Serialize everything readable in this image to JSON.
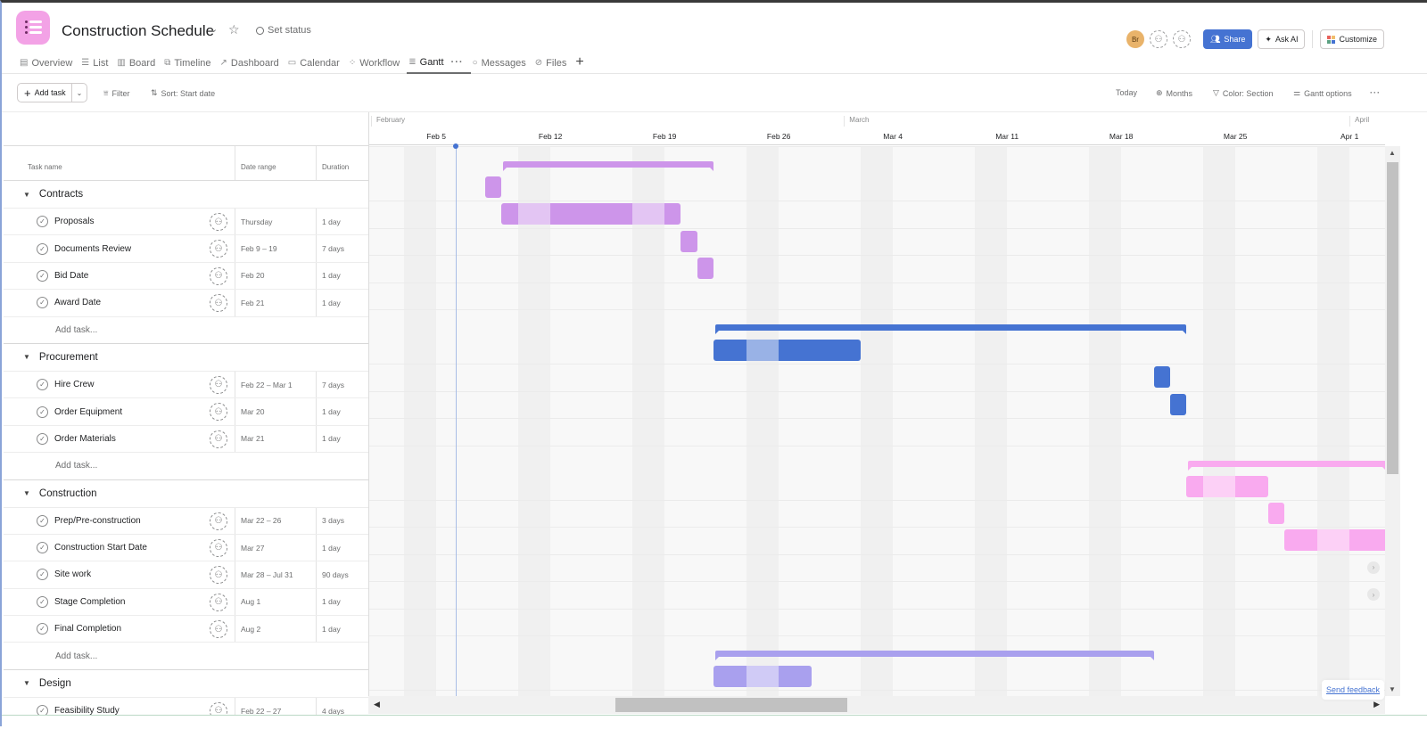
{
  "project": {
    "title": "Construction Schedule",
    "set_status": "Set status",
    "icon_color": "#f3a2e6"
  },
  "tabs": [
    {
      "label": "Overview",
      "icon": "overview-icon",
      "glyph": "▤"
    },
    {
      "label": "List",
      "icon": "list-icon",
      "glyph": "☰"
    },
    {
      "label": "Board",
      "icon": "board-icon",
      "glyph": "▥"
    },
    {
      "label": "Timeline",
      "icon": "timeline-icon",
      "glyph": "⧉"
    },
    {
      "label": "Dashboard",
      "icon": "dashboard-icon",
      "glyph": "↗"
    },
    {
      "label": "Calendar",
      "icon": "calendar-icon",
      "glyph": "▭"
    },
    {
      "label": "Workflow",
      "icon": "workflow-icon",
      "glyph": "⁘"
    },
    {
      "label": "Gantt",
      "icon": "gantt-icon",
      "glyph": "≣",
      "active": true
    },
    {
      "label": "Messages",
      "icon": "messages-icon",
      "glyph": "○"
    },
    {
      "label": "Files",
      "icon": "files-icon",
      "glyph": "⊘"
    }
  ],
  "header_right": {
    "avatar_initials": "Br",
    "share_label": "Share",
    "ask_ai_label": "Ask AI",
    "customize_label": "Customize",
    "share_color": "#4573d2"
  },
  "toolbar": {
    "add_task_label": "Add task",
    "filter_label": "Filter",
    "sort_label": "Sort: Start date",
    "today_label": "Today",
    "zoom_label": "Months",
    "color_label": "Color: Section",
    "options_label": "Gantt options"
  },
  "list_header": {
    "name": "Task name",
    "date": "Date range",
    "duration": "Duration"
  },
  "add_task_row_label": "Add task...",
  "sections": [
    {
      "name": "Contracts",
      "color": "#cd95ea",
      "bracket": {
        "start": "2024-02-09",
        "end": "2024-02-21"
      },
      "tasks": [
        {
          "name": "Proposals",
          "date_range": "Thursday",
          "duration": "1 day",
          "start": "2024-02-08",
          "end": "2024-02-08"
        },
        {
          "name": "Documents Review",
          "date_range": "Feb 9 – 19",
          "duration": "7 days",
          "start": "2024-02-09",
          "end": "2024-02-19"
        },
        {
          "name": "Bid Date",
          "date_range": "Feb 20",
          "duration": "1 day",
          "start": "2024-02-20",
          "end": "2024-02-20"
        },
        {
          "name": "Award Date",
          "date_range": "Feb 21",
          "duration": "1 day",
          "start": "2024-02-21",
          "end": "2024-02-21"
        }
      ],
      "has_add_row": true
    },
    {
      "name": "Procurement",
      "color": "#4573d2",
      "bracket": {
        "start": "2024-02-22",
        "end": "2024-03-21"
      },
      "tasks": [
        {
          "name": "Hire Crew",
          "date_range": "Feb 22 – Mar 1",
          "duration": "7 days",
          "start": "2024-02-22",
          "end": "2024-03-01"
        },
        {
          "name": "Order Equipment",
          "date_range": "Mar 20",
          "duration": "1 day",
          "start": "2024-03-20",
          "end": "2024-03-20"
        },
        {
          "name": "Order Materials",
          "date_range": "Mar 21",
          "duration": "1 day",
          "start": "2024-03-21",
          "end": "2024-03-21"
        }
      ],
      "has_add_row": true
    },
    {
      "name": "Construction",
      "color": "#f9aaef",
      "bracket": {
        "start": "2024-03-22",
        "end": "2024-08-02"
      },
      "tasks": [
        {
          "name": "Prep/Pre-construction",
          "date_range": "Mar 22 – 26",
          "duration": "3 days",
          "start": "2024-03-22",
          "end": "2024-03-26"
        },
        {
          "name": "Construction Start Date",
          "date_range": "Mar 27",
          "duration": "1 day",
          "start": "2024-03-27",
          "end": "2024-03-27"
        },
        {
          "name": "Site work",
          "date_range": "Mar 28 – Jul 31",
          "duration": "90 days",
          "start": "2024-03-28",
          "end": "2024-07-31"
        },
        {
          "name": "Stage Completion",
          "date_range": "Aug 1",
          "duration": "1 day",
          "start": "2024-08-01",
          "end": "2024-08-01",
          "offscreen": true
        },
        {
          "name": "Final Completion",
          "date_range": "Aug 2",
          "duration": "1 day",
          "start": "2024-08-02",
          "end": "2024-08-02",
          "offscreen": true
        }
      ],
      "has_add_row": true
    },
    {
      "name": "Design",
      "color": "#a9a0ee",
      "bracket": {
        "start": "2024-02-22",
        "end": "2024-03-19"
      },
      "tasks": [
        {
          "name": "Feasibility Study",
          "date_range": "Feb 22 – 27",
          "duration": "4 days",
          "start": "2024-02-22",
          "end": "2024-02-27"
        }
      ],
      "has_add_row": false
    }
  ],
  "timeline": {
    "months": [
      {
        "label": "February",
        "date": "2024-02-01"
      },
      {
        "label": "March",
        "date": "2024-03-01"
      },
      {
        "label": "April",
        "date": "2024-04-01"
      }
    ],
    "weeks": [
      {
        "label": "Feb 5",
        "date": "2024-02-05"
      },
      {
        "label": "Feb 12",
        "date": "2024-02-12"
      },
      {
        "label": "Feb 19",
        "date": "2024-02-19"
      },
      {
        "label": "Feb 26",
        "date": "2024-02-26"
      },
      {
        "label": "Mar 4",
        "date": "2024-03-04"
      },
      {
        "label": "Mar 11",
        "date": "2024-03-11"
      },
      {
        "label": "Mar 18",
        "date": "2024-03-18"
      },
      {
        "label": "Mar 25",
        "date": "2024-03-25"
      },
      {
        "label": "Apr 1",
        "date": "2024-04-01"
      }
    ],
    "visible_start": "2024-02-01",
    "today": "2024-02-06"
  },
  "send_feedback_label": "Send feedback"
}
